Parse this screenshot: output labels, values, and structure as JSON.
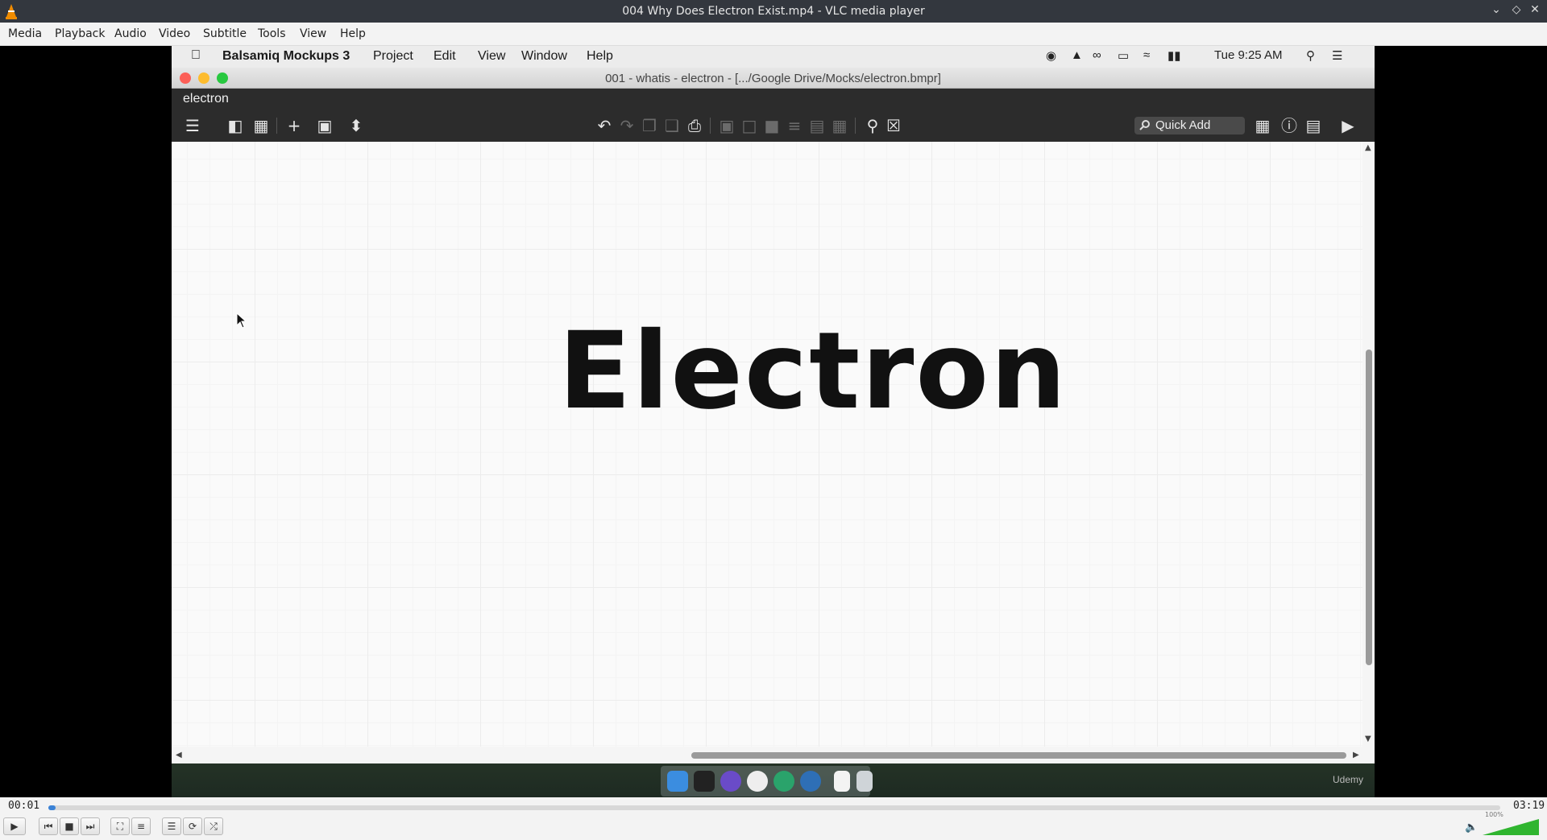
{
  "vlc": {
    "window_title": "004 Why Does Electron Exist.mp4 - VLC media player",
    "menu": [
      "Media",
      "Playback",
      "Audio",
      "Video",
      "Subtitle",
      "Tools",
      "View",
      "Help"
    ],
    "time_elapsed": "00:01",
    "time_total": "03:19",
    "progress": 0.005,
    "volume_label": "100%",
    "volume": 1.0
  },
  "mac": {
    "app_name": "Balsamiq Mockups 3",
    "menu": [
      "Project",
      "Edit",
      "View",
      "Window",
      "Help"
    ],
    "clock": "Tue 9:25 AM"
  },
  "balsamiq": {
    "window_title": "001 - whatis - electron - [.../Google Drive/Mocks/electron.bmpr]",
    "project_name": "electron",
    "quick_add_label": "Quick Add",
    "canvas_text": "Electron"
  },
  "dock": {
    "watermark": "Udemy"
  },
  "colors": {
    "vlc_title_bg": "#33373e",
    "toolbar_bg": "#2c2c2c",
    "seek_fill": "#3b82d6",
    "traffic_red": "#fc5f57",
    "traffic_yellow": "#fdbc2e",
    "traffic_green": "#28c840"
  }
}
